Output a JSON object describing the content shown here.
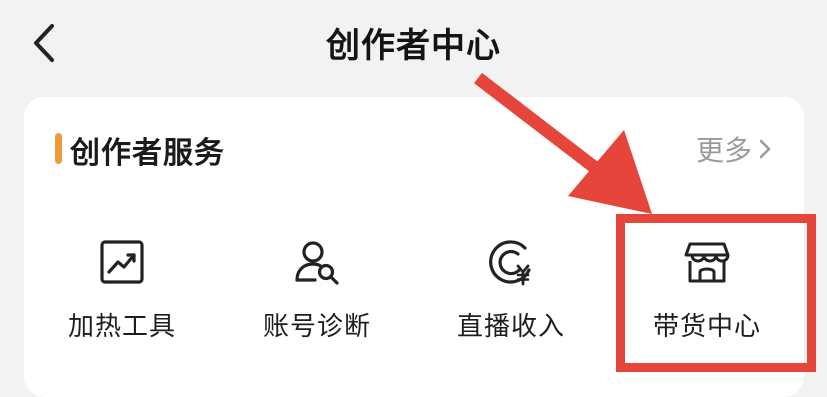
{
  "header": {
    "title": "创作者中心"
  },
  "section": {
    "title": "创作者服务",
    "more_label": "更多"
  },
  "tools": [
    {
      "label": "加热工具",
      "icon": "trend-chart-icon"
    },
    {
      "label": "账号诊断",
      "icon": "user-search-icon"
    },
    {
      "label": "直播收入",
      "icon": "live-income-icon"
    },
    {
      "label": "带货中心",
      "icon": "storefront-icon"
    }
  ],
  "colors": {
    "accent": "#f29a3a",
    "annotation": "#e5453a",
    "background": "#f2f2f2",
    "muted": "#9a9a9a"
  }
}
